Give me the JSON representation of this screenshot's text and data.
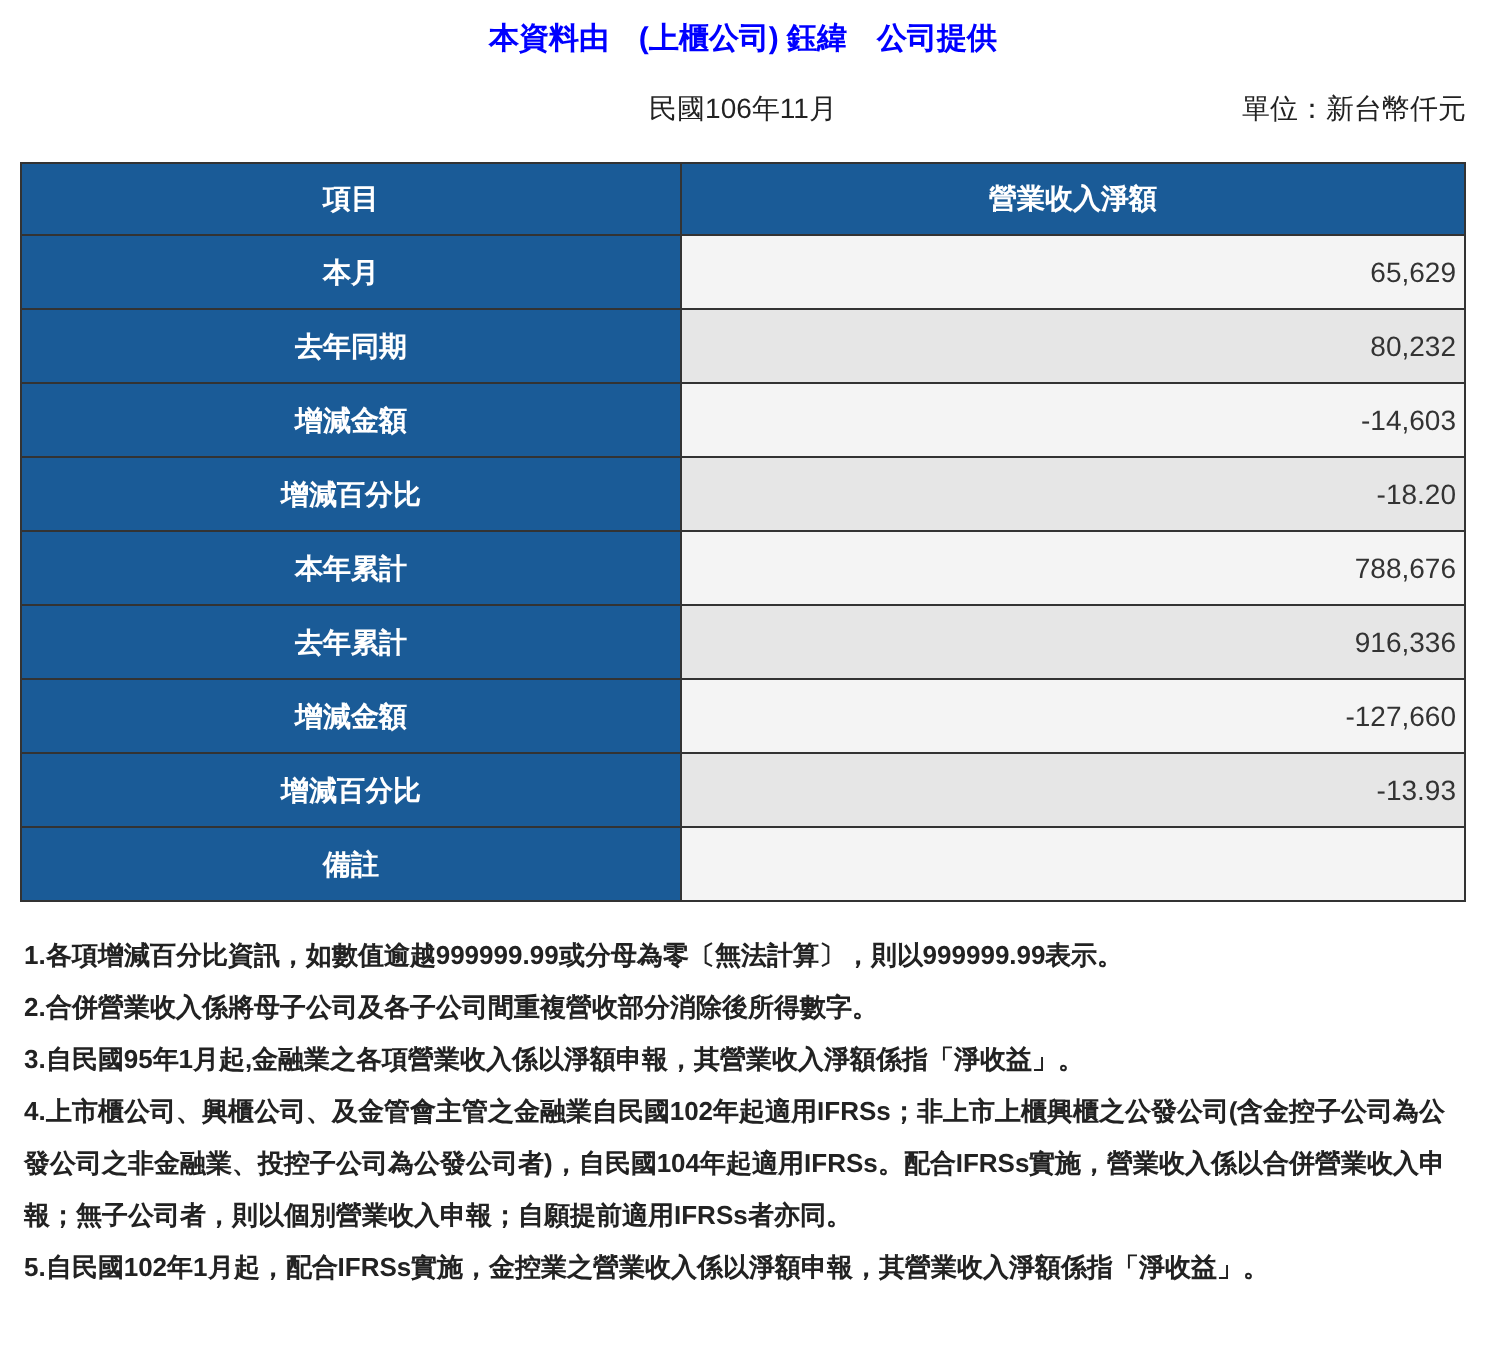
{
  "title": "本資料由　(上櫃公司) 鈺緯　公司提供",
  "period": "民國106年11月",
  "unit": "單位：新台幣仟元",
  "table": {
    "columns": [
      "項目",
      "營業收入淨額"
    ],
    "rows": [
      {
        "label": "本月",
        "value": "65,629"
      },
      {
        "label": "去年同期",
        "value": "80,232"
      },
      {
        "label": "增減金額",
        "value": "-14,603"
      },
      {
        "label": "增減百分比",
        "value": "-18.20"
      },
      {
        "label": "本年累計",
        "value": "788,676"
      },
      {
        "label": "去年累計",
        "value": "916,336"
      },
      {
        "label": "增減金額",
        "value": "-127,660"
      },
      {
        "label": "增減百分比",
        "value": "-13.93"
      },
      {
        "label": "備註"
      }
    ]
  },
  "notes": [
    "1.各項增減百分比資訊，如數值逾越999999.99或分母為零〔無法計算〕，則以999999.99表示。",
    "2.合併營業收入係將母子公司及各子公司間重複營收部分消除後所得數字。",
    "3.自民國95年1月起,金融業之各項營業收入係以淨額申報，其營業收入淨額係指「淨收益」。",
    "4.上市櫃公司、興櫃公司、及金管會主管之金融業自民國102年起適用IFRSs；非上市上櫃興櫃之公發公司(含金控子公司為公發公司之非金融業、投控子公司為公發公司者)，自民國104年起適用IFRSs。配合IFRSs實施，營業收入係以合併營業收入申報；無子公司者，則以個別營業收入申報；自願提前適用IFRSs者亦同。",
    "5.自民國102年1月起，配合IFRSs實施，金控業之營業收入係以淨額申報，其營業收入淨額係指「淨收益」。"
  ]
}
